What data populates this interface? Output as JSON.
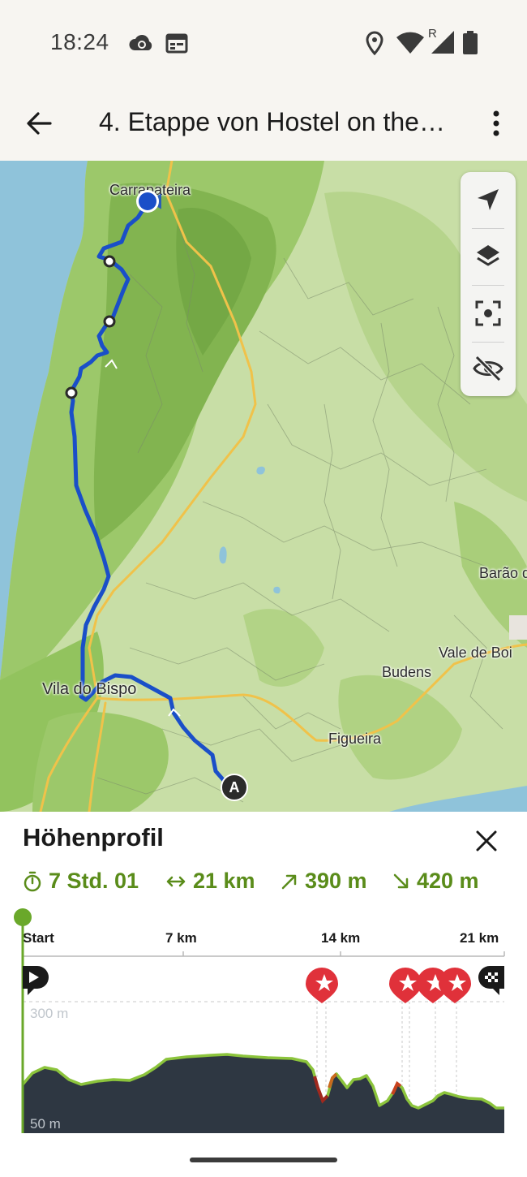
{
  "status_bar": {
    "time": "18:24",
    "icons": [
      "cloud-sync-icon",
      "calendar-icon",
      "location-icon",
      "wifi-icon",
      "signal-roaming-icon",
      "battery-icon"
    ],
    "roaming_mark": "R"
  },
  "app_bar": {
    "title": "4. Etappe von Hostel on the…",
    "back_icon": "arrow-back-icon",
    "more_icon": "more-vert-icon"
  },
  "map": {
    "labels": {
      "carrapateira": "Carrapateira",
      "vila_do_bispo": "Vila do Bispo",
      "budens": "Budens",
      "figueira": "Figueira",
      "vale_de_boi": "Vale de Boi",
      "barao": "Barão d"
    },
    "start_marker": "A",
    "controls": [
      "navigation-arrow-icon",
      "layers-icon",
      "focus-route-icon",
      "visibility-off-icon"
    ],
    "colors": {
      "route": "#1a4fc8",
      "road": "#f0c24a",
      "water": "#8fc3da",
      "land": "#c4dca0",
      "forest": "#8cbf5a"
    }
  },
  "elevation": {
    "title": "Höhenprofil",
    "close_icon": "close-icon",
    "stats": {
      "duration": "7 Std. 01",
      "distance": "21 km",
      "ascent": "390 m",
      "descent": "420 m"
    },
    "axis": {
      "start": "Start",
      "km7": "7 km",
      "km14": "14 km",
      "km21": "21 km"
    },
    "y_labels": {
      "top": "300 m",
      "bottom": "50 m"
    },
    "markers": [
      "play-icon",
      "star-icon",
      "star-icon",
      "star-icon",
      "star-icon",
      "finish-flag-icon"
    ],
    "colors": {
      "accent": "#5a8c1a",
      "profile_fill": "#2e3742",
      "profile_line": "#8cc43c",
      "steep": "#a0281e",
      "poi": "#e0313a"
    }
  }
}
